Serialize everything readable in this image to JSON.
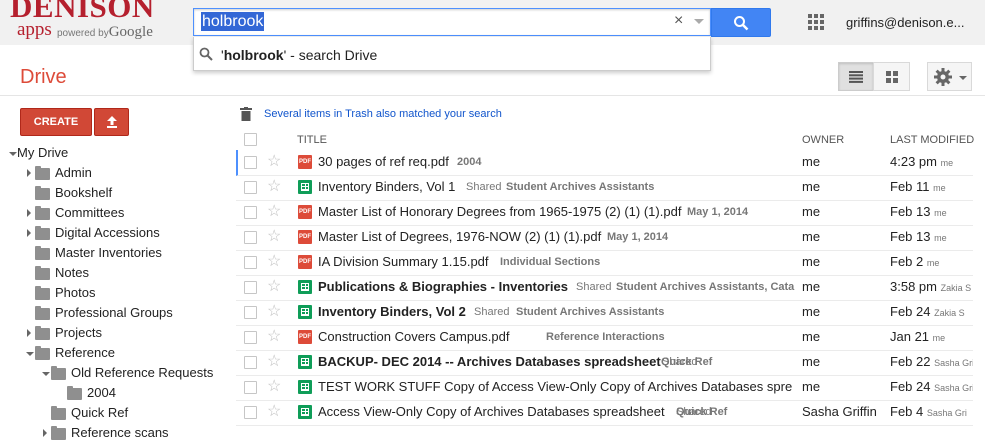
{
  "branding": {
    "name": "DENISON",
    "sub": "apps",
    "powered": "powered by",
    "google": "Google"
  },
  "search": {
    "query": "holbrook",
    "clear": "×"
  },
  "suggestion": {
    "quoted": "holbrook",
    "rest": " - search Drive",
    "q_open": "'",
    "q_close": "'"
  },
  "account": {
    "email": "griffins@denison.e..."
  },
  "app": {
    "title": "Drive"
  },
  "left": {
    "create": "CREATE",
    "tree": [
      {
        "label": "My Drive"
      },
      {
        "label": "Admin"
      },
      {
        "label": "Bookshelf"
      },
      {
        "label": "Committees"
      },
      {
        "label": "Digital Accessions"
      },
      {
        "label": "Master Inventories"
      },
      {
        "label": "Notes"
      },
      {
        "label": "Photos"
      },
      {
        "label": "Professional Groups"
      },
      {
        "label": "Projects"
      },
      {
        "label": "Reference"
      },
      {
        "label": "Old Reference Requests"
      },
      {
        "label": "2004"
      },
      {
        "label": "Quick Ref"
      },
      {
        "label": "Reference scans"
      }
    ]
  },
  "notice": "Several items in Trash also matched your search",
  "columns": {
    "title": "TITLE",
    "owner": "OWNER",
    "modified": "LAST MODIFIED"
  },
  "files": [
    {
      "name": "30 pages of ref req.pdf",
      "meta": "2004",
      "owner": "me",
      "modified": "4:23 pm",
      "by": "me"
    },
    {
      "name": "Inventory Binders, Vol 1",
      "shared": "Shared",
      "meta": "Student Archives Assistants",
      "owner": "me",
      "modified": "Feb 11",
      "by": "me"
    },
    {
      "name": "Master List of Honorary Degrees from 1965-1975 (2) (1) (1).pdf",
      "meta": "May 1, 2014",
      "owner": "me",
      "modified": "Feb 13",
      "by": "me"
    },
    {
      "name": "Master List of Degrees, 1976-NOW (2) (1) (1).pdf",
      "meta": "May 1, 2014",
      "owner": "me",
      "modified": "Feb 13",
      "by": "me"
    },
    {
      "name": "IA Division Summary 1.15.pdf",
      "meta": "Individual Sections",
      "owner": "me",
      "modified": "Feb 2",
      "by": "me"
    },
    {
      "name": "Publications & Biographies - Inventories",
      "shared": "Shared",
      "meta": "Student Archives Assistants, Cata",
      "owner": "me",
      "modified": "3:58 pm",
      "by": "Zakia S"
    },
    {
      "name": "Inventory Binders, Vol 2",
      "shared": "Shared",
      "meta": "Student Archives Assistants",
      "owner": "me",
      "modified": "Feb 24",
      "by": "Zakia S"
    },
    {
      "name": "Construction Covers Campus.pdf",
      "meta": "Reference Interactions",
      "owner": "me",
      "modified": "Jan 21",
      "by": "me"
    },
    {
      "name": "BACKUP- DEC 2014 -- Archives Databases spreadsheet",
      "shared": "Shared",
      "meta": "Quick Ref",
      "owner": "me",
      "modified": "Feb 22",
      "by": "Sasha Gri"
    },
    {
      "name": "TEST WORK STUFF Copy of Access View-Only Copy of Archives Databases spre",
      "owner": "me",
      "modified": "Feb 24",
      "by": "Sasha Gri"
    },
    {
      "name": "Access View-Only Copy of Archives Databases spreadsheet",
      "shared": "Shared",
      "meta": "Quick Ref",
      "owner": "Sasha Griffin",
      "modified": "Feb 4",
      "by": "Sasha Gri"
    }
  ],
  "pdf_badge": "PDF"
}
